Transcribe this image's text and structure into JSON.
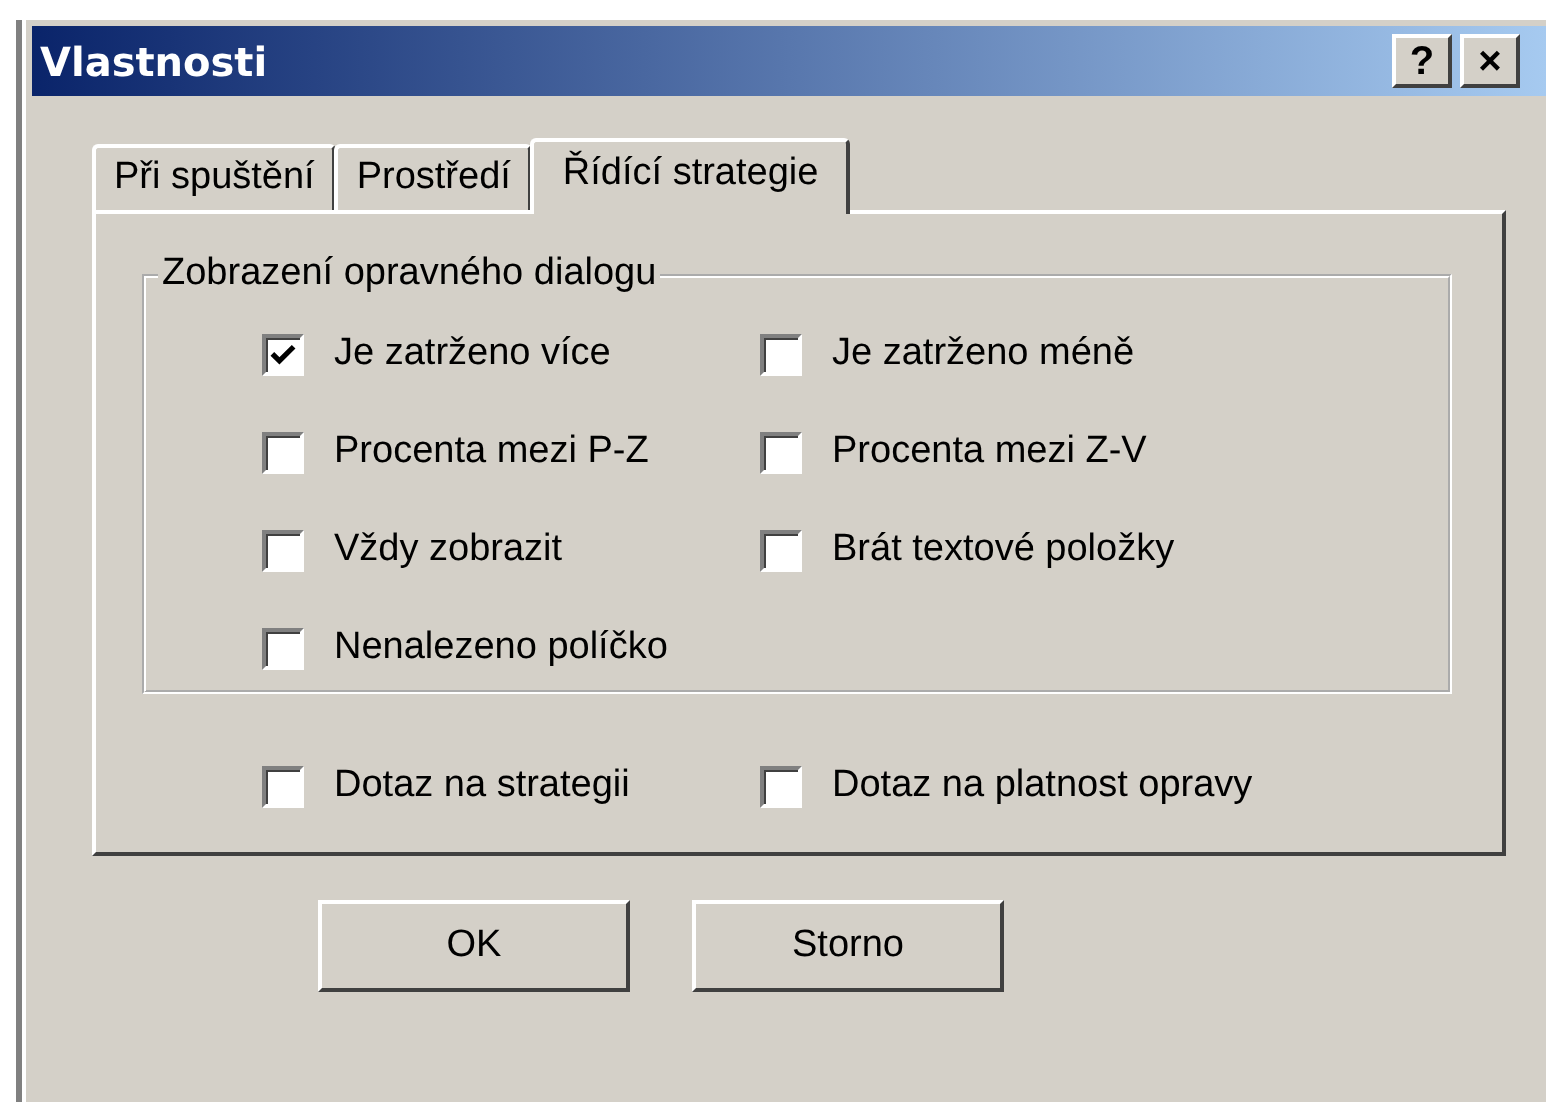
{
  "window": {
    "title": "Vlastnosti",
    "help_button": "?",
    "close_button": "×"
  },
  "tabs": [
    {
      "label": "Při spuštění",
      "selected": false
    },
    {
      "label": "Prostředí",
      "selected": false
    },
    {
      "label": "Řídící strategie",
      "selected": true
    }
  ],
  "group": {
    "title": "Zobrazení opravného dialogu",
    "options": [
      {
        "label": "Je zatrženo více",
        "checked": true
      },
      {
        "label": "Je zatrženo méně",
        "checked": false
      },
      {
        "label": "Procenta mezi P-Z",
        "checked": false
      },
      {
        "label": "Procenta mezi Z-V",
        "checked": false
      },
      {
        "label": "Vždy zobrazit",
        "checked": false
      },
      {
        "label": "Brát textové položky",
        "checked": false
      },
      {
        "label": "Nenalezeno políčko",
        "checked": false
      }
    ]
  },
  "options": [
    {
      "label": "Dotaz na strategii",
      "checked": false
    },
    {
      "label": "Dotaz na platnost opravy",
      "checked": false
    }
  ],
  "buttons": [
    "OK",
    "Storno"
  ]
}
